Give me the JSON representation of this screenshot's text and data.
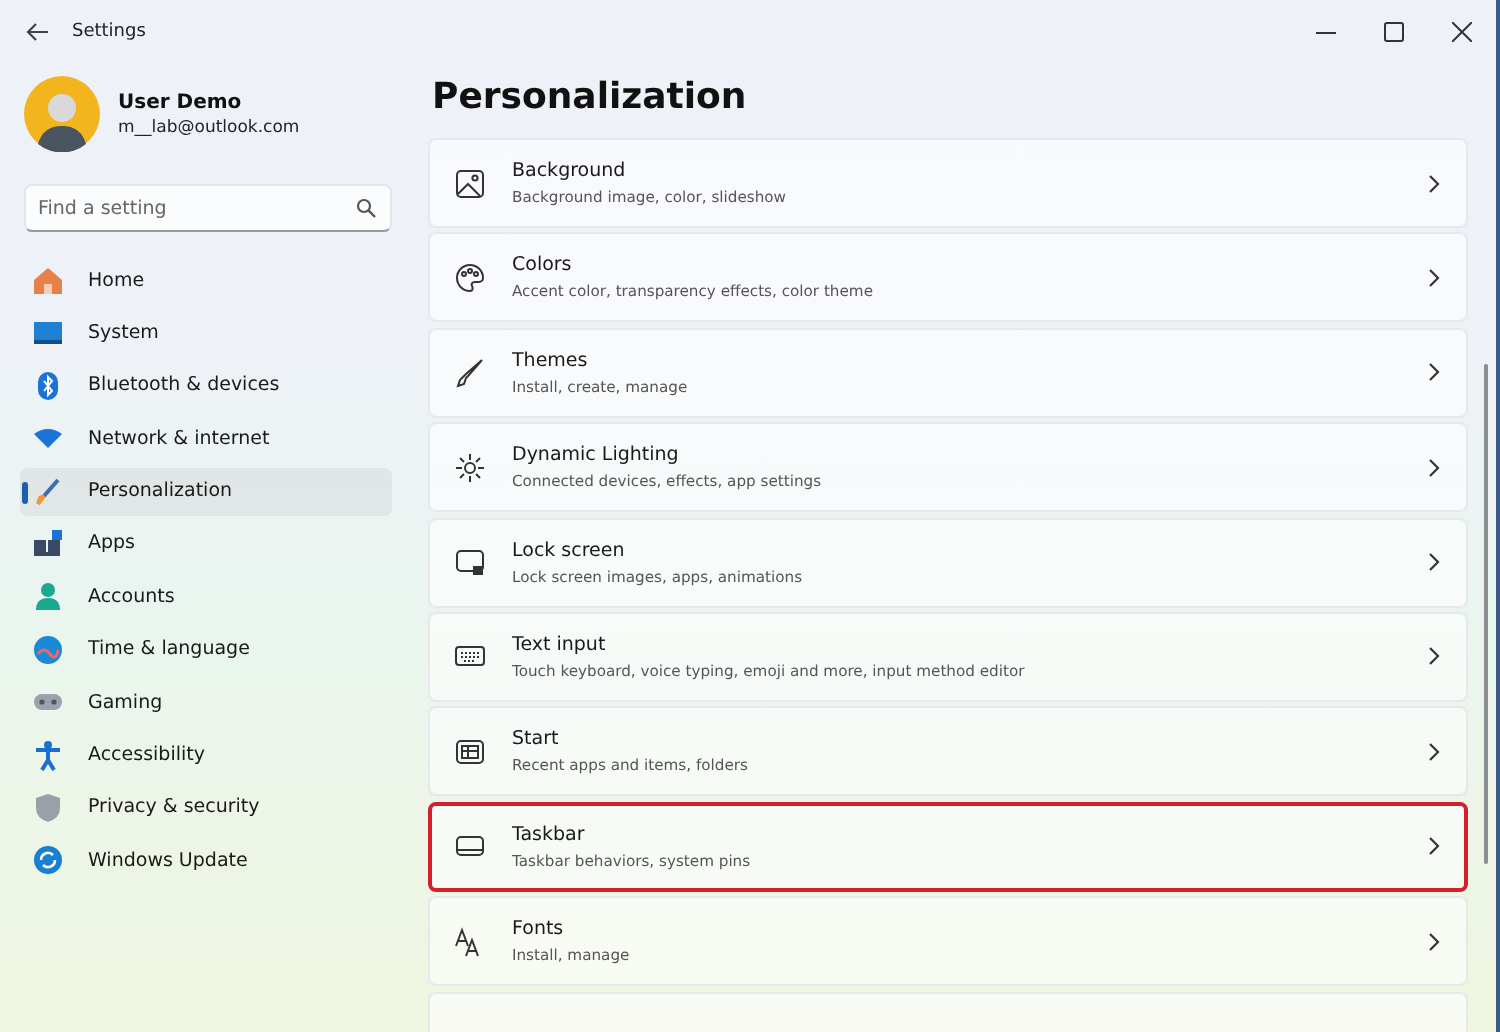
{
  "window": {
    "title": "Settings"
  },
  "profile": {
    "name": "User Demo",
    "email": "m__lab@outlook.com"
  },
  "search": {
    "placeholder": "Find a setting"
  },
  "sidebar": {
    "items": [
      {
        "label": "Home",
        "selected": false
      },
      {
        "label": "System",
        "selected": false
      },
      {
        "label": "Bluetooth & devices",
        "selected": false
      },
      {
        "label": "Network & internet",
        "selected": false
      },
      {
        "label": "Personalization",
        "selected": true
      },
      {
        "label": "Apps",
        "selected": false
      },
      {
        "label": "Accounts",
        "selected": false
      },
      {
        "label": "Time & language",
        "selected": false
      },
      {
        "label": "Gaming",
        "selected": false
      },
      {
        "label": "Accessibility",
        "selected": false
      },
      {
        "label": "Privacy & security",
        "selected": false
      },
      {
        "label": "Windows Update",
        "selected": false
      }
    ]
  },
  "page": {
    "title": "Personalization",
    "cards": [
      {
        "title": "Background",
        "subtitle": "Background image, color, slideshow",
        "highlighted": false
      },
      {
        "title": "Colors",
        "subtitle": "Accent color, transparency effects, color theme",
        "highlighted": false
      },
      {
        "title": "Themes",
        "subtitle": "Install, create, manage",
        "highlighted": false
      },
      {
        "title": "Dynamic Lighting",
        "subtitle": "Connected devices, effects, app settings",
        "highlighted": false
      },
      {
        "title": "Lock screen",
        "subtitle": "Lock screen images, apps, animations",
        "highlighted": false
      },
      {
        "title": "Text input",
        "subtitle": "Touch keyboard, voice typing, emoji and more, input method editor",
        "highlighted": false
      },
      {
        "title": "Start",
        "subtitle": "Recent apps and items, folders",
        "highlighted": false
      },
      {
        "title": "Taskbar",
        "subtitle": "Taskbar behaviors, system pins",
        "highlighted": true
      },
      {
        "title": "Fonts",
        "subtitle": "Install, manage",
        "highlighted": false
      }
    ]
  }
}
